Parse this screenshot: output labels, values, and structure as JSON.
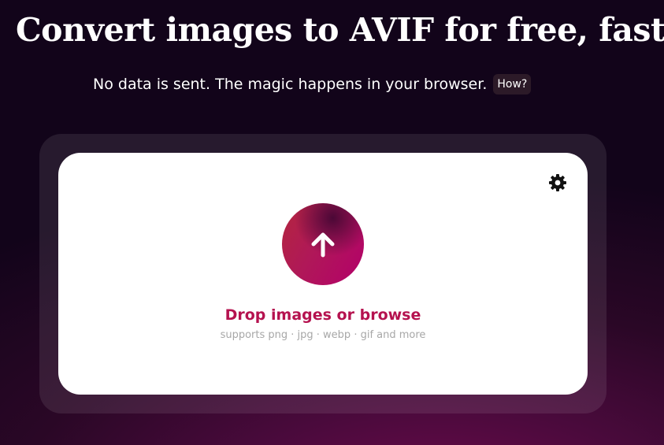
{
  "header": {
    "headline": "Convert images to AVIF for free, fast.",
    "subline": "No data is sent. The magic happens in your browser.",
    "how_label": "How?"
  },
  "dropzone": {
    "settings_icon": "gear-icon",
    "upload_icon": "arrow-up-icon",
    "title": "Drop images or browse",
    "hint": "supports png · jpg · webp · gif and more"
  },
  "colors": {
    "accent": "#b5124f",
    "upload_gradient": [
      "#b3263e",
      "#b3006a"
    ],
    "background_dark": "#12041a",
    "background_glow": "#6e0a4c"
  }
}
